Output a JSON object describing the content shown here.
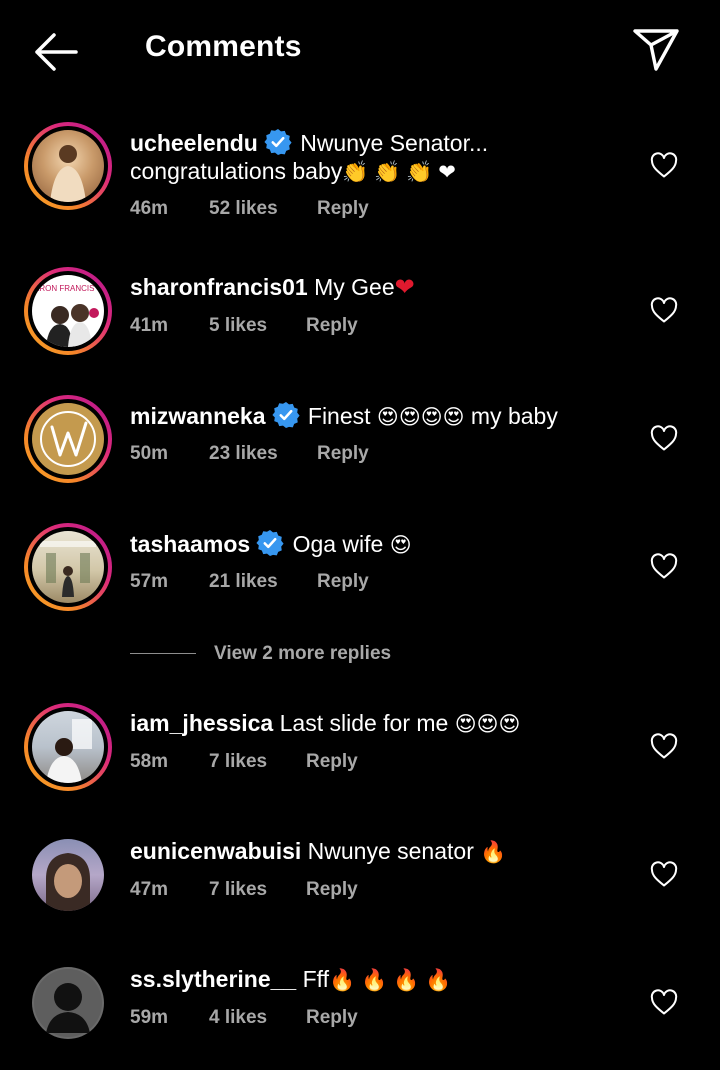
{
  "header": {
    "title": "Comments"
  },
  "colors": {
    "background": "#000000",
    "verified": "#3797f0",
    "meta_text": "#a8a8a8",
    "heart": "#e0192e"
  },
  "comments": [
    {
      "username": "ucheelendu",
      "verified": true,
      "text": "Nwunye Senator... congratulations baby",
      "emojis": "👏 👏 👏 ❤",
      "time": "46m",
      "likes": "52 likes",
      "reply": "Reply"
    },
    {
      "username": "sharonfrancis01",
      "verified": false,
      "text": "My Gee",
      "emojis": "❤",
      "time": "41m",
      "likes": "5 likes",
      "reply": "Reply"
    },
    {
      "username": "mizwanneka",
      "verified": true,
      "text": "Finest",
      "emojis": "😍😍😍😍",
      "text_after": "my baby",
      "time": "50m",
      "likes": "23 likes",
      "reply": "Reply"
    },
    {
      "username": "tashaamos",
      "verified": true,
      "text": "Oga wife",
      "emojis": "😍",
      "time": "57m",
      "likes": "21 likes",
      "reply": "Reply"
    },
    {
      "username": "iam_jhessica",
      "verified": false,
      "text": "Last slide for me",
      "emojis": "😍😍😍",
      "time": "58m",
      "likes": "7 likes",
      "reply": "Reply"
    },
    {
      "username": "eunicenwabuisi",
      "verified": false,
      "text": "Nwunye senator",
      "emojis": "🔥",
      "time": "47m",
      "likes": "7 likes",
      "reply": "Reply"
    },
    {
      "username": "ss.slytherine__",
      "verified": false,
      "text": "Fff",
      "emojis": "🔥 🔥 🔥 🔥",
      "time": "59m",
      "likes": "4 likes",
      "reply": "Reply"
    }
  ],
  "view_more": "View 2 more replies",
  "avatar_text": {
    "sharonfrancis01": "ARON FRANCIS T"
  }
}
